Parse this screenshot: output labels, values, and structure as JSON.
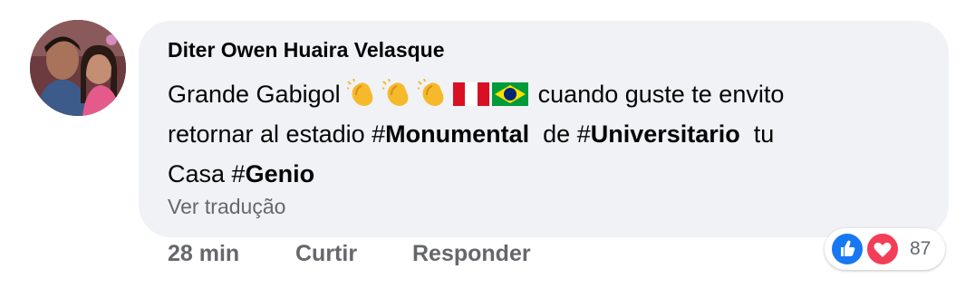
{
  "comment": {
    "author": "Diter Owen Huaira Velasque",
    "text": {
      "part1": "Grande Gabigol",
      "part2": " cuando guste te envito",
      "part3": "retornar al estadio ",
      "hash1": "#",
      "tag1": "Monumental",
      "part4": "  de ",
      "hash2": "#",
      "tag2": "Universitario",
      "part5": "  tu",
      "part6": "Casa ",
      "hash3": "#",
      "tag3": "Genio"
    },
    "emojis": [
      "clapping-hands-icon",
      "clapping-hands-icon",
      "clapping-hands-icon",
      "peru-flag-icon",
      "brazil-flag-icon"
    ],
    "translate_label": "Ver tradução"
  },
  "actions": {
    "time": "28 min",
    "like_label": "Curtir",
    "reply_label": "Responder"
  },
  "reactions": {
    "types": [
      "like-icon",
      "love-icon"
    ],
    "count": "87"
  },
  "colors": {
    "bubble": "#f0f2f5",
    "secondary_text": "#65676b",
    "like_blue": "#1877f2",
    "love_red": "#f33e58"
  }
}
